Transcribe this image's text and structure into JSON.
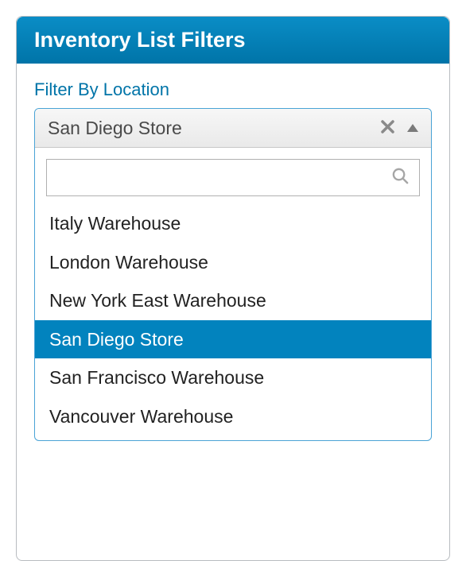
{
  "header": {
    "title": "Inventory List Filters"
  },
  "filter": {
    "label": "Filter By Location",
    "selected_value": "San Diego Store",
    "search_value": "",
    "options": [
      {
        "label": "Italy Warehouse",
        "selected": false
      },
      {
        "label": "London Warehouse",
        "selected": false
      },
      {
        "label": "New York East Warehouse",
        "selected": false
      },
      {
        "label": "San Diego Store",
        "selected": true
      },
      {
        "label": "San Francisco Warehouse",
        "selected": false
      },
      {
        "label": "Vancouver Warehouse",
        "selected": false
      }
    ]
  },
  "colors": {
    "brand_primary": "#0283be",
    "brand_dark": "#0074a8",
    "border_focus": "#4aa3d6"
  }
}
